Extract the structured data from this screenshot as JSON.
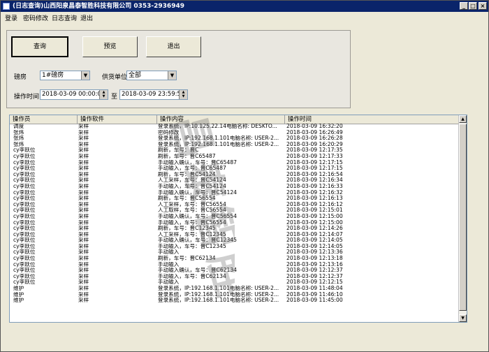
{
  "window": {
    "title": "(日志查询)山西阳泉昌泰智胜科技有限公司  0353-2936949",
    "min_glyph": "_",
    "max_glyph": "□",
    "close_glyph": "×"
  },
  "menu": [
    "登录",
    "密码修改",
    "日志查询",
    "退出"
  ],
  "buttons": {
    "query": "查询",
    "preview": "预览",
    "exit": "退出"
  },
  "filters": {
    "warehouse_label": "磅房",
    "warehouse_value": "1#磅房",
    "supplier_label": "供货单位",
    "supplier_value": "全部",
    "time_label": "操作时间",
    "start_time": "2018-03-09 00:00:00",
    "to_label": "至",
    "end_time": "2018-03-09 23:59:59"
  },
  "table": {
    "columns": [
      "操作员",
      "操作软件",
      "操作内容",
      "操作时间"
    ],
    "rows": [
      [
        "调度",
        "采样",
        "登录系统，IP:10.125.22.14电脑名称: DESKTO...",
        "2018-03-09 16:32:20"
      ],
      [
        "张炜",
        "采样",
        "密码修改",
        "2018-03-09 16:26:49"
      ],
      [
        "张炜",
        "采样",
        "登录系统，IP:192.168.1.101电脑名称: USER-2...",
        "2018-03-09 16:26:28"
      ],
      [
        "张炜",
        "采样",
        "登录系统，IP:192.168.1.101电脑名称: USER-2...",
        "2018-03-09 16:20:29"
      ],
      [
        "cy李跃位",
        "采样",
        "刷新，车号：晋C",
        "2018-03-09 12:17:35"
      ],
      [
        "cy李跃位",
        "采样",
        "刷新，车号：晋C65487",
        "2018-03-09 12:17:33"
      ],
      [
        "cy李跃位",
        "采样",
        "手动输入确认，车号：晋C65487",
        "2018-03-09 12:17:15"
      ],
      [
        "cy李跃位",
        "采样",
        "手动输入，车号：晋C65487",
        "2018-03-09 12:17:15"
      ],
      [
        "cy李跃位",
        "采样",
        "刷新，车号：晋C54124",
        "2018-03-09 12:16:54"
      ],
      [
        "cy李跃位",
        "采样",
        "人工采样，车号：晋C54124",
        "2018-03-09 12:16:34"
      ],
      [
        "cy李跃位",
        "采样",
        "手动输入，车号：晋C54124",
        "2018-03-09 12:16:33"
      ],
      [
        "cy李跃位",
        "采样",
        "手动输入确认，车号：晋C54124",
        "2018-03-09 12:16:32"
      ],
      [
        "cy李跃位",
        "采样",
        "刷新，车号：晋C56554",
        "2018-03-09 12:16:13"
      ],
      [
        "cy李跃位",
        "采样",
        "人工采样，车号：晋C56554",
        "2018-03-09 12:16:12"
      ],
      [
        "cy李跃位",
        "采样",
        "人工取样，车号：晋C56554",
        "2018-03-09 12:15:01"
      ],
      [
        "cy李跃位",
        "采样",
        "手动输入确认，车号：晋C56554",
        "2018-03-09 12:15:00"
      ],
      [
        "cy李跃位",
        "采样",
        "手动输入，车号：晋C56554",
        "2018-03-09 12:15:00"
      ],
      [
        "cy李跃位",
        "采样",
        "刷新，车号：晋C12345",
        "2018-03-09 12:14:26"
      ],
      [
        "cy李跃位",
        "采样",
        "人工采样，车号：晋C12345",
        "2018-03-09 12:14:07"
      ],
      [
        "cy李跃位",
        "采样",
        "手动输入确认，车号：晋C12345",
        "2018-03-09 12:14:05"
      ],
      [
        "cy李跃位",
        "采样",
        "手动输入，车号：晋C12345",
        "2018-03-09 12:14:05"
      ],
      [
        "cy李跃位",
        "采样",
        "手动输入",
        "2018-03-09 12:13:36"
      ],
      [
        "cy李跃位",
        "采样",
        "刷新，车号：晋C62134",
        "2018-03-09 12:13:18"
      ],
      [
        "cy李跃位",
        "采样",
        "手动输入",
        "2018-03-09 12:13:16"
      ],
      [
        "cy李跃位",
        "采样",
        "手动输入确认，车号：晋C62134",
        "2018-03-09 12:12:37"
      ],
      [
        "cy李跃位",
        "采样",
        "手动输入，车号：晋C62134",
        "2018-03-09 12:12:37"
      ],
      [
        "cy李跃位",
        "采样",
        "手动输入",
        "2018-03-09 12:12:15"
      ],
      [
        "维护",
        "采样",
        "登录系统，IP:192.168.1.101电脑名称: USER-2...",
        "2018-03-09 11:48:04"
      ],
      [
        "维护",
        "采样",
        "登录系统，IP:192.168.1.101电脑名称: USER-2...",
        "2018-03-09 11:46:10"
      ],
      [
        "维护",
        "采样",
        "登录系统，IP:192.168.1.101电脑名称: USER-2...",
        "2018-03-09 11:45:00"
      ]
    ]
  },
  "scroll_glyphs": {
    "up": "▲",
    "down": "▼"
  },
  "combo_glyph": "▼",
  "spin_glyphs": {
    "up": "▲",
    "down": "▼"
  },
  "watermark_text": "昌泰智胜"
}
